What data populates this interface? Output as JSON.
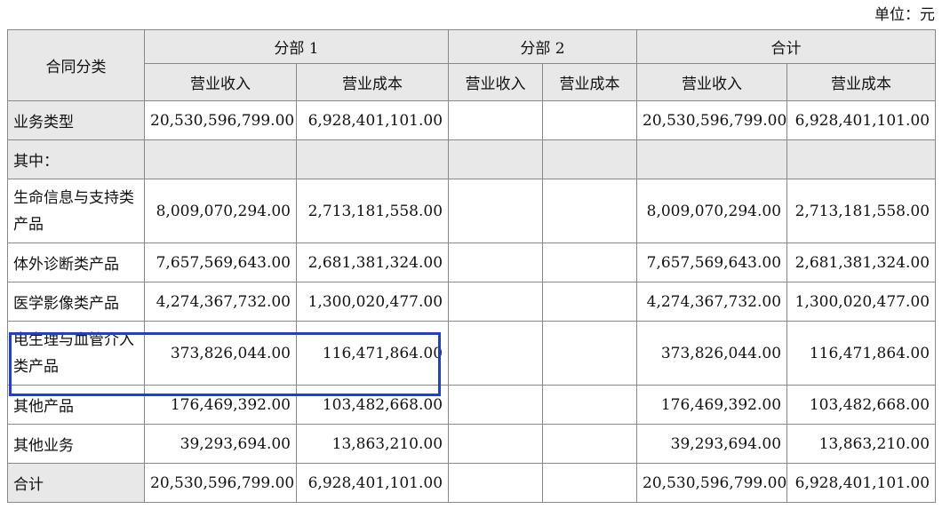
{
  "unit": "单位：元",
  "headers": {
    "contract_category": "合同分类",
    "segment1": "分部 1",
    "segment2": "分部 2",
    "total": "合计",
    "revenue": "营业收入",
    "cost": "营业成本"
  },
  "rows": [
    {
      "label": "业务类型",
      "s1_rev": "20,530,596,799.00",
      "s1_cost": "6,928,401,101.00",
      "s2_rev": "",
      "s2_cost": "",
      "t_rev": "20,530,596,799.00",
      "t_cost": "6,928,401,101.00"
    },
    {
      "label": "其中：",
      "s1_rev": "",
      "s1_cost": "",
      "s2_rev": "",
      "s2_cost": "",
      "t_rev": "",
      "t_cost": ""
    },
    {
      "label": "生命信息与支持类产品",
      "s1_rev": "8,009,070,294.00",
      "s1_cost": "2,713,181,558.00",
      "s2_rev": "",
      "s2_cost": "",
      "t_rev": "8,009,070,294.00",
      "t_cost": "2,713,181,558.00"
    },
    {
      "label": "体外诊断类产品",
      "s1_rev": "7,657,569,643.00",
      "s1_cost": "2,681,381,324.00",
      "s2_rev": "",
      "s2_cost": "",
      "t_rev": "7,657,569,643.00",
      "t_cost": "2,681,381,324.00"
    },
    {
      "label": "医学影像类产品",
      "s1_rev": "4,274,367,732.00",
      "s1_cost": "1,300,020,477.00",
      "s2_rev": "",
      "s2_cost": "",
      "t_rev": "4,274,367,732.00",
      "t_cost": "1,300,020,477.00"
    },
    {
      "label": "电生理与血管介入类产品",
      "s1_rev": "373,826,044.00",
      "s1_cost": "116,471,864.00",
      "s2_rev": "",
      "s2_cost": "",
      "t_rev": "373,826,044.00",
      "t_cost": "116,471,864.00"
    },
    {
      "label": "其他产品",
      "s1_rev": "176,469,392.00",
      "s1_cost": "103,482,668.00",
      "s2_rev": "",
      "s2_cost": "",
      "t_rev": "176,469,392.00",
      "t_cost": "103,482,668.00"
    },
    {
      "label": "其他业务",
      "s1_rev": "39,293,694.00",
      "s1_cost": "13,863,210.00",
      "s2_rev": "",
      "s2_cost": "",
      "t_rev": "39,293,694.00",
      "t_cost": "13,863,210.00"
    },
    {
      "label": "合计",
      "s1_rev": "20,530,596,799.00",
      "s1_cost": "6,928,401,101.00",
      "s2_rev": "",
      "s2_cost": "",
      "t_rev": "20,530,596,799.00",
      "t_cost": "6,928,401,101.00"
    }
  ],
  "highlight_color": "#1f3fd0"
}
